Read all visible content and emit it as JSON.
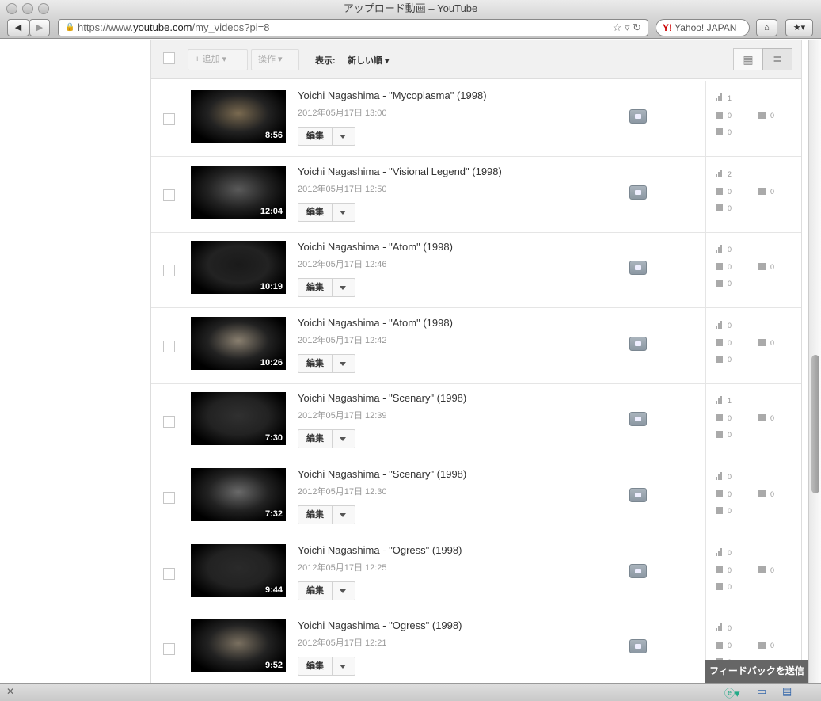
{
  "window": {
    "title": "アップロード動画 – YouTube"
  },
  "browser": {
    "url_prefix": "https://www.",
    "url_domain": "youtube.com",
    "url_path": "/my_videos?pi=8",
    "search_text": "Yahoo! JAPAN"
  },
  "toolbar": {
    "add_label": "+ 追加",
    "actions_label": "操作",
    "sort_label": "表示:",
    "sort_value": "新しい順"
  },
  "edit_label": "編集",
  "videos": [
    {
      "title": "Yoichi Nagashima - \"Mycoplasma\" (1998)",
      "date": "2012年05月17日 13:00",
      "duration": "8:56",
      "views": "1",
      "likes": "0",
      "dislikes": "0",
      "comments": "0"
    },
    {
      "title": "Yoichi Nagashima - \"Visional Legend\" (1998)",
      "date": "2012年05月17日 12:50",
      "duration": "12:04",
      "views": "2",
      "likes": "0",
      "dislikes": "0",
      "comments": "0"
    },
    {
      "title": "Yoichi Nagashima - \"Atom\" (1998)",
      "date": "2012年05月17日 12:46",
      "duration": "10:19",
      "views": "0",
      "likes": "0",
      "dislikes": "0",
      "comments": "0"
    },
    {
      "title": "Yoichi Nagashima - \"Atom\" (1998)",
      "date": "2012年05月17日 12:42",
      "duration": "10:26",
      "views": "0",
      "likes": "0",
      "dislikes": "0",
      "comments": "0"
    },
    {
      "title": "Yoichi Nagashima - \"Scenary\" (1998)",
      "date": "2012年05月17日 12:39",
      "duration": "7:30",
      "views": "1",
      "likes": "0",
      "dislikes": "0",
      "comments": "0"
    },
    {
      "title": "Yoichi Nagashima - \"Scenary\" (1998)",
      "date": "2012年05月17日 12:30",
      "duration": "7:32",
      "views": "0",
      "likes": "0",
      "dislikes": "0",
      "comments": "0"
    },
    {
      "title": "Yoichi Nagashima - \"Ogress\" (1998)",
      "date": "2012年05月17日 12:25",
      "duration": "9:44",
      "views": "0",
      "likes": "0",
      "dislikes": "0",
      "comments": "0"
    },
    {
      "title": "Yoichi Nagashima - \"Ogress\" (1998)",
      "date": "2012年05月17日 12:21",
      "duration": "9:52",
      "views": "0",
      "likes": "0",
      "dislikes": "0",
      "comments": "0"
    }
  ],
  "feedback_label": "フィードバックを送信"
}
